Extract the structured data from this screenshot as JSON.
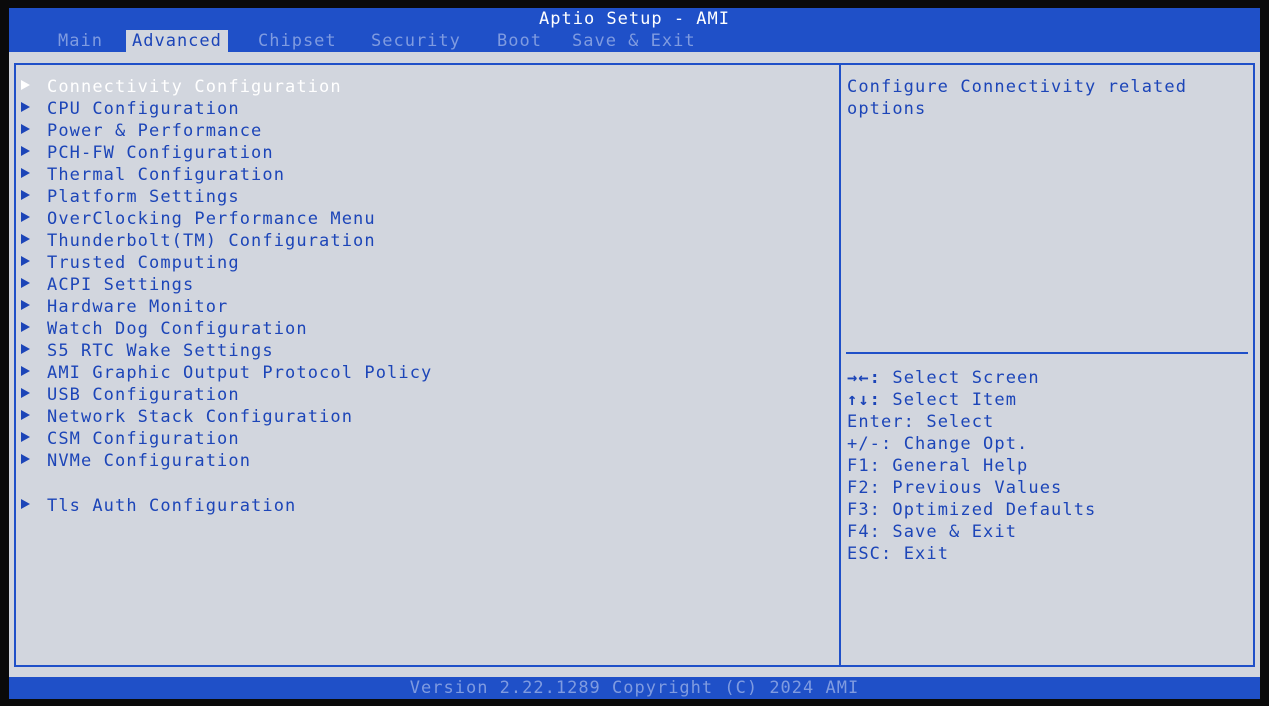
{
  "header": {
    "title": "Aptio Setup - AMI",
    "tabs": [
      {
        "label": "Main",
        "active": false
      },
      {
        "label": "Advanced",
        "active": true
      },
      {
        "label": "Chipset",
        "active": false
      },
      {
        "label": "Security",
        "active": false
      },
      {
        "label": "Boot",
        "active": false
      },
      {
        "label": "Save & Exit",
        "active": false
      }
    ]
  },
  "menu": {
    "items": [
      {
        "label": "Connectivity Configuration",
        "selected": true
      },
      {
        "label": "CPU Configuration"
      },
      {
        "label": "Power & Performance"
      },
      {
        "label": "PCH-FW Configuration"
      },
      {
        "label": "Thermal Configuration"
      },
      {
        "label": "Platform Settings"
      },
      {
        "label": "OverClocking Performance Menu"
      },
      {
        "label": "Thunderbolt(TM) Configuration"
      },
      {
        "label": "Trusted Computing"
      },
      {
        "label": "ACPI Settings"
      },
      {
        "label": "Hardware Monitor"
      },
      {
        "label": "Watch Dog Configuration"
      },
      {
        "label": "S5 RTC Wake Settings"
      },
      {
        "label": "AMI Graphic Output Protocol Policy"
      },
      {
        "label": "USB Configuration"
      },
      {
        "label": "Network Stack Configuration"
      },
      {
        "label": "CSM Configuration"
      },
      {
        "label": "NVMe Configuration"
      },
      {
        "label": "Tls Auth Configuration"
      }
    ]
  },
  "help": {
    "text": "Configure Connectivity related options"
  },
  "keys": [
    {
      "key": "→←:",
      "action": "Select Screen"
    },
    {
      "key": "↑↓:",
      "action": "Select Item"
    },
    {
      "key": "Enter:",
      "action": "Select"
    },
    {
      "key": "+/-:",
      "action": "Change Opt."
    },
    {
      "key": "F1:",
      "action": "General Help"
    },
    {
      "key": "F2:",
      "action": "Previous Values"
    },
    {
      "key": "F3:",
      "action": "Optimized Defaults"
    },
    {
      "key": "F4:",
      "action": "Save & Exit"
    },
    {
      "key": "ESC:",
      "action": "Exit"
    }
  ],
  "footer": {
    "version": "Version 2.22.1289 Copyright (C) 2024 AMI"
  },
  "colors": {
    "accent": "#1f50c8",
    "panel_bg": "#d2d6de",
    "text": "#1c45b8",
    "inactive_tab": "#7f9be0",
    "selected_text": "#ffffff"
  }
}
